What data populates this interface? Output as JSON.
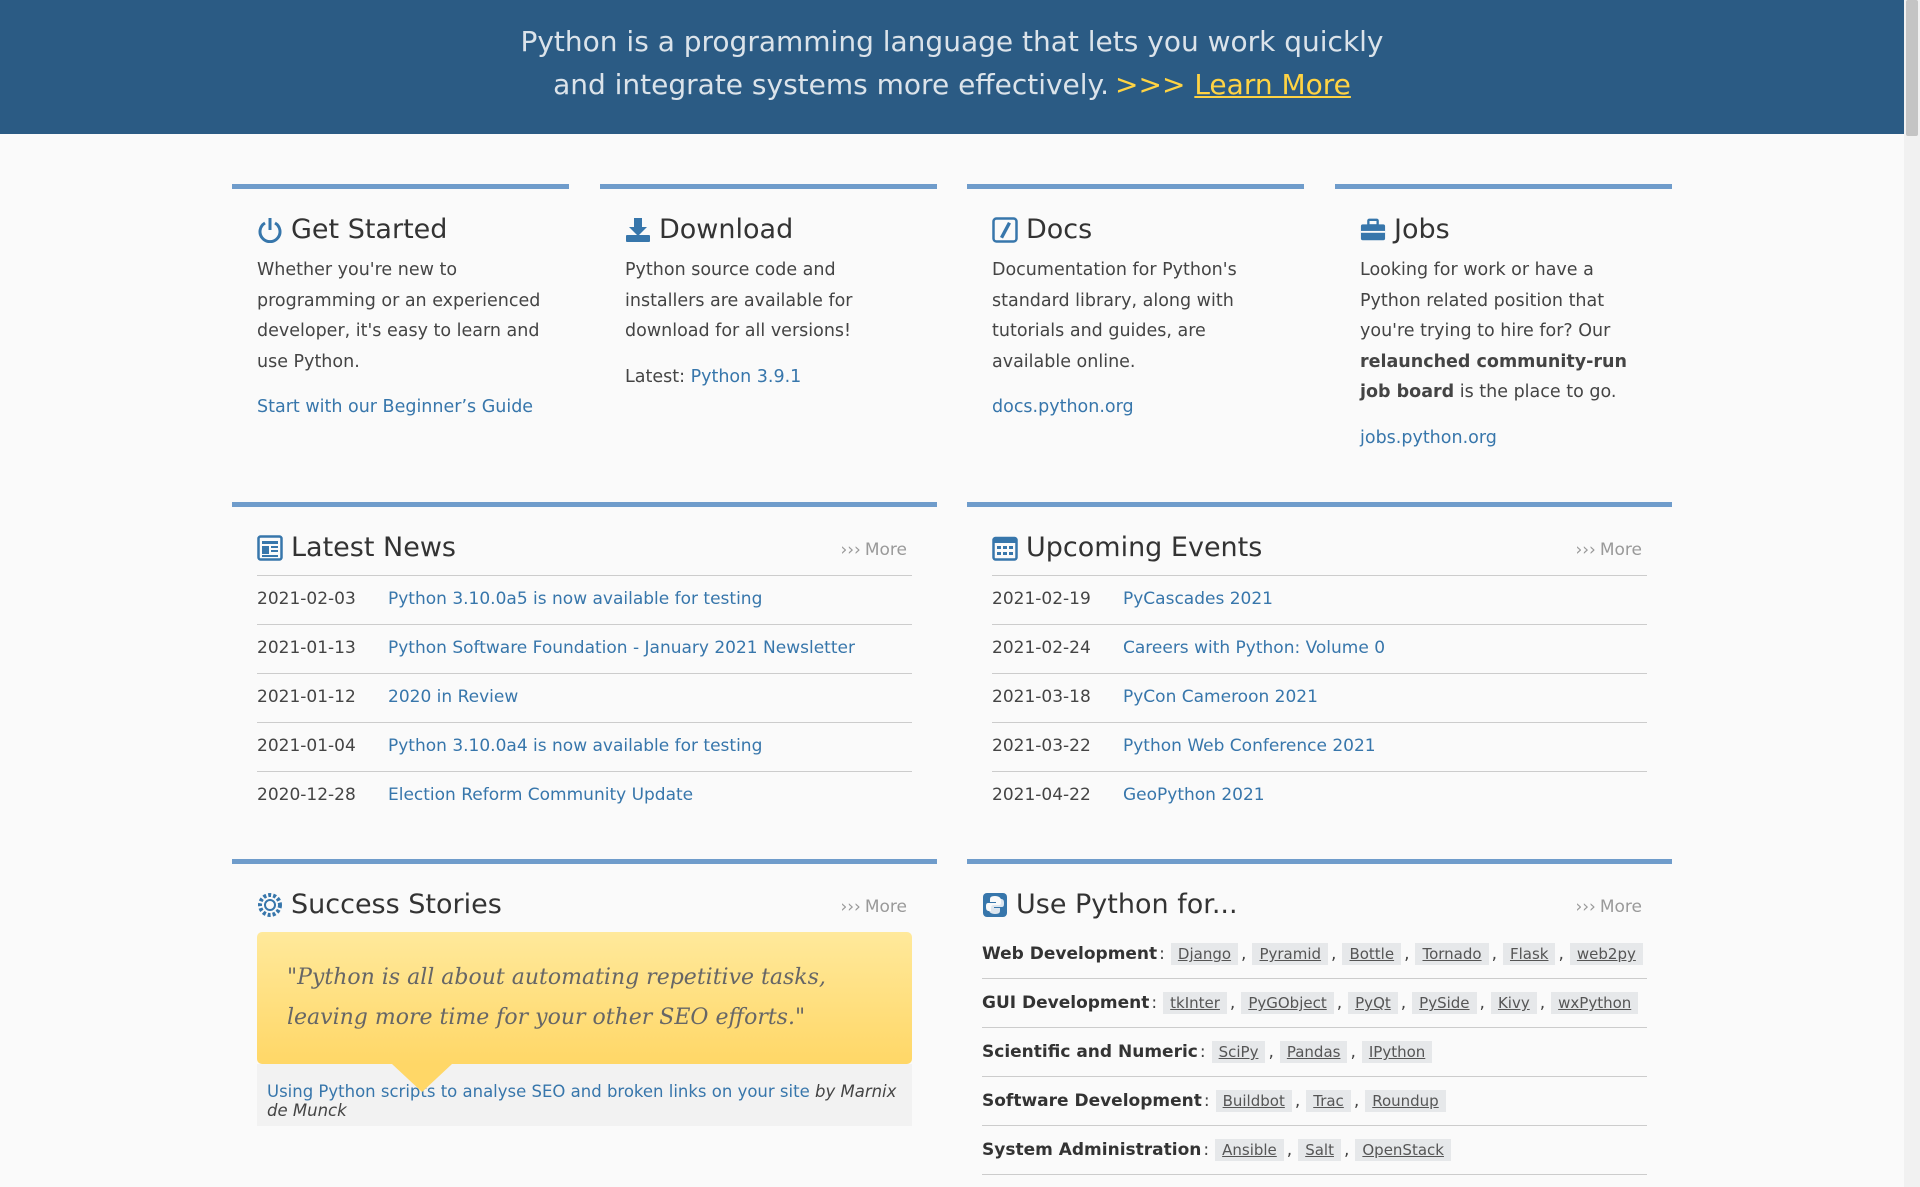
{
  "hero": {
    "line1": "Python is a programming language that lets you work quickly",
    "line2": "and integrate systems more effectively.",
    "chevrons": ">>>",
    "learn_more": "Learn More"
  },
  "get_started": {
    "title": "Get Started",
    "icon": "power-icon",
    "text": "Whether you're new to programming or an experienced developer, it's easy to learn and use Python.",
    "link": "Start with our Beginner’s Guide"
  },
  "download": {
    "title": "Download",
    "icon": "download-icon",
    "text": "Python source code and installers are available for download for all versions!",
    "latest_label": "Latest:",
    "latest_link": "Python 3.9.1"
  },
  "docs": {
    "title": "Docs",
    "icon": "docs-icon",
    "text": "Documentation for Python's standard library, along with tutorials and guides, are available online.",
    "link": "docs.python.org"
  },
  "jobs": {
    "title": "Jobs",
    "icon": "briefcase-icon",
    "text_before": "Looking for work or have a Python related position that you're trying to hire for? Our",
    "text_bold": "relaunched community-run job board",
    "text_after": "is the place to go.",
    "link": "jobs.python.org"
  },
  "latest_news": {
    "title": "Latest News",
    "icon": "news-icon",
    "more": "More",
    "items": [
      {
        "date": "2021-02-03",
        "title": "Python 3.10.0a5 is now available for testing"
      },
      {
        "date": "2021-01-13",
        "title": "Python Software Foundation - January 2021 Newsletter"
      },
      {
        "date": "2021-01-12",
        "title": "2020 in Review"
      },
      {
        "date": "2021-01-04",
        "title": "Python 3.10.0a4 is now available for testing"
      },
      {
        "date": "2020-12-28",
        "title": "Election Reform Community Update"
      }
    ]
  },
  "events": {
    "title": "Upcoming Events",
    "icon": "calendar-icon",
    "more": "More",
    "items": [
      {
        "date": "2021-02-19",
        "title": "PyCascades 2021"
      },
      {
        "date": "2021-02-24",
        "title": "Careers with Python: Volume 0"
      },
      {
        "date": "2021-03-18",
        "title": "PyCon Cameroon 2021"
      },
      {
        "date": "2021-03-22",
        "title": "Python Web Conference 2021"
      },
      {
        "date": "2021-04-22",
        "title": "GeoPython 2021"
      }
    ]
  },
  "success": {
    "title": "Success Stories",
    "icon": "star-badge-icon",
    "more": "More",
    "quote": "\"Python is all about automating repetitive tasks, leaving more time for your other SEO efforts.\"",
    "story_link": "Using Python scripts to analyse SEO and broken links on your site",
    "author": "by Marnix de Munck"
  },
  "use_python": {
    "title": "Use Python for...",
    "icon": "python-logo-icon",
    "more": "More",
    "rows": [
      {
        "label": "Web Development",
        "tags": [
          "Django",
          "Pyramid",
          "Bottle",
          "Tornado",
          "Flask",
          "web2py"
        ]
      },
      {
        "label": "GUI Development",
        "tags": [
          "tkInter",
          "PyGObject",
          "PyQt",
          "PySide",
          "Kivy",
          "wxPython"
        ]
      },
      {
        "label": "Scientific and Numeric",
        "tags": [
          "SciPy",
          "Pandas",
          "IPython"
        ]
      },
      {
        "label": "Software Development",
        "tags": [
          "Buildbot",
          "Trac",
          "Roundup"
        ]
      },
      {
        "label": "System Administration",
        "tags": [
          "Ansible",
          "Salt",
          "OpenStack"
        ]
      }
    ]
  },
  "colors": {
    "hero_bg": "#2b5b84",
    "accent_yellow": "#ffd343",
    "link_blue": "#3776ab",
    "widget_border": "#6f9ccb"
  }
}
